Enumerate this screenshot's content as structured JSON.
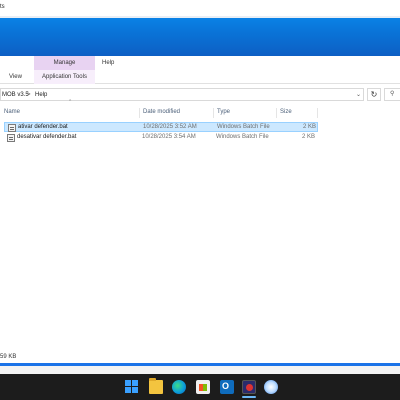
{
  "window": {
    "title_fragment": "ts"
  },
  "ribbon": {
    "manage_label": "Manage",
    "help_label": "Help",
    "view_label": "View",
    "application_tools_label": "Application Tools"
  },
  "address": {
    "crumbs": [
      "MOB v3.5",
      "Help"
    ],
    "separator": ">",
    "refresh_icon": "refresh-icon",
    "search_icon": "search-icon"
  },
  "columns": {
    "name": "Name",
    "date_modified": "Date modified",
    "type": "Type",
    "size": "Size"
  },
  "files": [
    {
      "name": "ativar defender.bat",
      "date": "10/28/2025 3:52 AM",
      "type": "Windows Batch File",
      "size": "2 KB",
      "selected": true
    },
    {
      "name": "desativar defender.bat",
      "date": "10/28/2025 3:54 AM",
      "type": "Windows Batch File",
      "size": "2 KB",
      "selected": false
    }
  ],
  "status": {
    "text": "59 KB"
  },
  "progress": {
    "fraction": 1.0
  },
  "taskbar": {
    "icons": [
      "windows-start-icon",
      "file-explorer-icon",
      "edge-icon",
      "microsoft-store-icon",
      "outlook-icon",
      "app-icon",
      "copilot-icon"
    ]
  },
  "colors": {
    "accent_blue": "#0a72d6",
    "manage_tab": "#e8d3f2",
    "selection": "#cce8ff",
    "taskbar": "#1c1c1c"
  }
}
